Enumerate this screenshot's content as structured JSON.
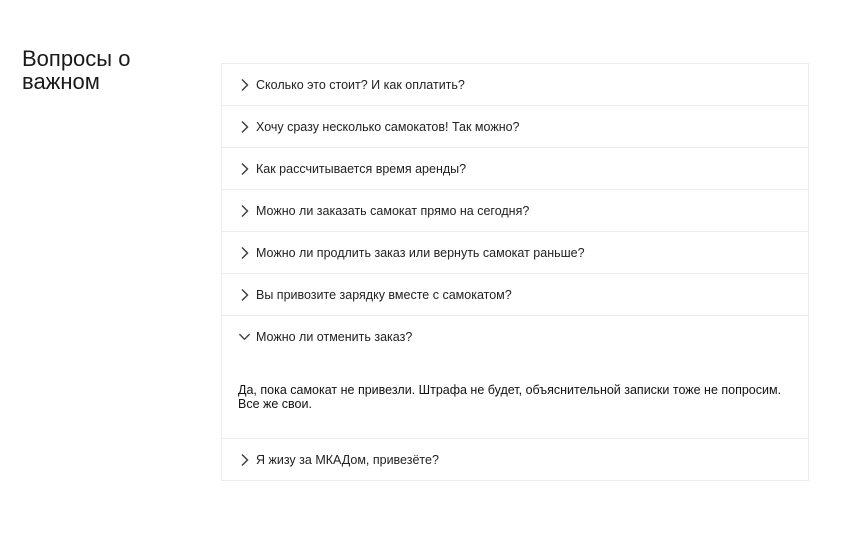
{
  "faq": {
    "title": "Вопросы о важном",
    "items": [
      {
        "question": "Сколько это стоит? И как оплатить?",
        "expanded": false,
        "icon": "chevron-right-icon"
      },
      {
        "question": "Хочу сразу несколько самокатов! Так можно?",
        "expanded": false,
        "icon": "chevron-right-icon"
      },
      {
        "question": "Как рассчитывается время аренды?",
        "expanded": false,
        "icon": "chevron-right-icon"
      },
      {
        "question": "Можно ли заказать самокат прямо на сегодня?",
        "expanded": false,
        "icon": "chevron-right-icon"
      },
      {
        "question": "Можно ли продлить заказ или вернуть самокат раньше?",
        "expanded": false,
        "icon": "chevron-right-icon"
      },
      {
        "question": "Вы привозите зарядку вместе с самокатом?",
        "expanded": false,
        "icon": "chevron-right-icon"
      },
      {
        "question": "Можно ли отменить заказ?",
        "expanded": true,
        "icon": "chevron-down-icon",
        "answer": "Да, пока самокат не привезли. Штрафа не будет, объяснительной записки тоже не попросим. Все же свои."
      },
      {
        "question": "Я жизу за МКАДом, привезёте?",
        "expanded": false,
        "icon": "chevron-right-icon"
      }
    ]
  },
  "colors": {
    "border": "#ececec",
    "chevron": "#444444",
    "text": "#222222"
  }
}
